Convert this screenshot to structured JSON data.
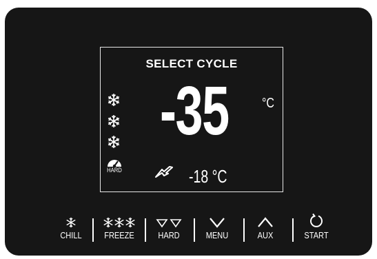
{
  "display": {
    "title": "SELECT CYCLE",
    "main_temperature": "-35",
    "main_unit": "°C",
    "probe_temperature": "-18 °C",
    "mode_label": "HARD",
    "snowflake_count": 3
  },
  "buttons": [
    {
      "id": "chill",
      "label": "CHILL",
      "icon": "snowflake-icon"
    },
    {
      "id": "freeze",
      "label": "FREEZE",
      "icon": "triple-snowflake-icon"
    },
    {
      "id": "hard",
      "label": "HARD",
      "icon": "double-triangle-down-icon"
    },
    {
      "id": "menu",
      "label": "MENU",
      "icon": "chevron-down-icon"
    },
    {
      "id": "aux",
      "label": "AUX",
      "icon": "chevron-up-icon"
    },
    {
      "id": "start",
      "label": "START",
      "icon": "restart-icon"
    }
  ],
  "colors": {
    "panel": "#161616",
    "text": "#ffffff"
  }
}
